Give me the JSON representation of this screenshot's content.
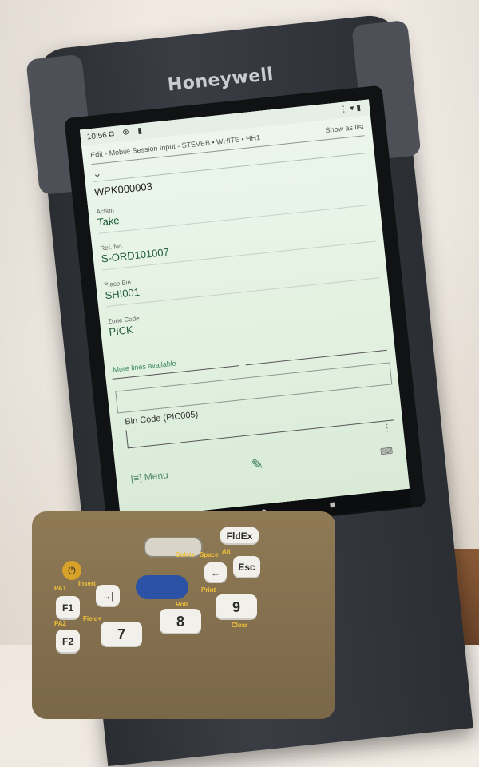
{
  "device": {
    "brand": "Honeywell"
  },
  "statusbar": {
    "time": "10:56",
    "left_icons": "◘ ⊛ ▮",
    "right_icons": "⋮▾▮"
  },
  "header": {
    "title": "Edit - Mobile Session Input - STEVEB • WHITE • HH1",
    "show_as_list": "Show as list"
  },
  "document": {
    "number": "WPK000003"
  },
  "fields": [
    {
      "label": "Action",
      "value": "Take"
    },
    {
      "label": "Ref. No.",
      "value": "S-ORD101007"
    },
    {
      "label": "Place Bin",
      "value": "SHI001"
    },
    {
      "label": "Zone Code",
      "value": "PICK"
    }
  ],
  "more_lines": "More lines available",
  "bin_code": {
    "label": "Bin Code (PIC005)",
    "value": ""
  },
  "footer": {
    "menu_label": "[≡] Menu",
    "edit_icon": "pencil-icon",
    "keyboard_icon": "keyboard-icon"
  },
  "navbar": {
    "back": "◀",
    "home": "●",
    "recent": "■"
  },
  "keypad": {
    "keys": {
      "f1": "F1",
      "f2": "F2",
      "tab": "→|",
      "enter": "←",
      "fldex": "FldEx",
      "esc": "Esc",
      "k7": "7",
      "k8": "8",
      "k9": "9"
    },
    "labels": {
      "pa1": "PA1",
      "insert": "Insert",
      "pa2": "PA2",
      "field_plus": "Field+",
      "delete": "Delete",
      "space": "Space",
      "alt": "Alt",
      "roll": "Roll",
      "print": "Print",
      "clear": "Clear"
    }
  }
}
